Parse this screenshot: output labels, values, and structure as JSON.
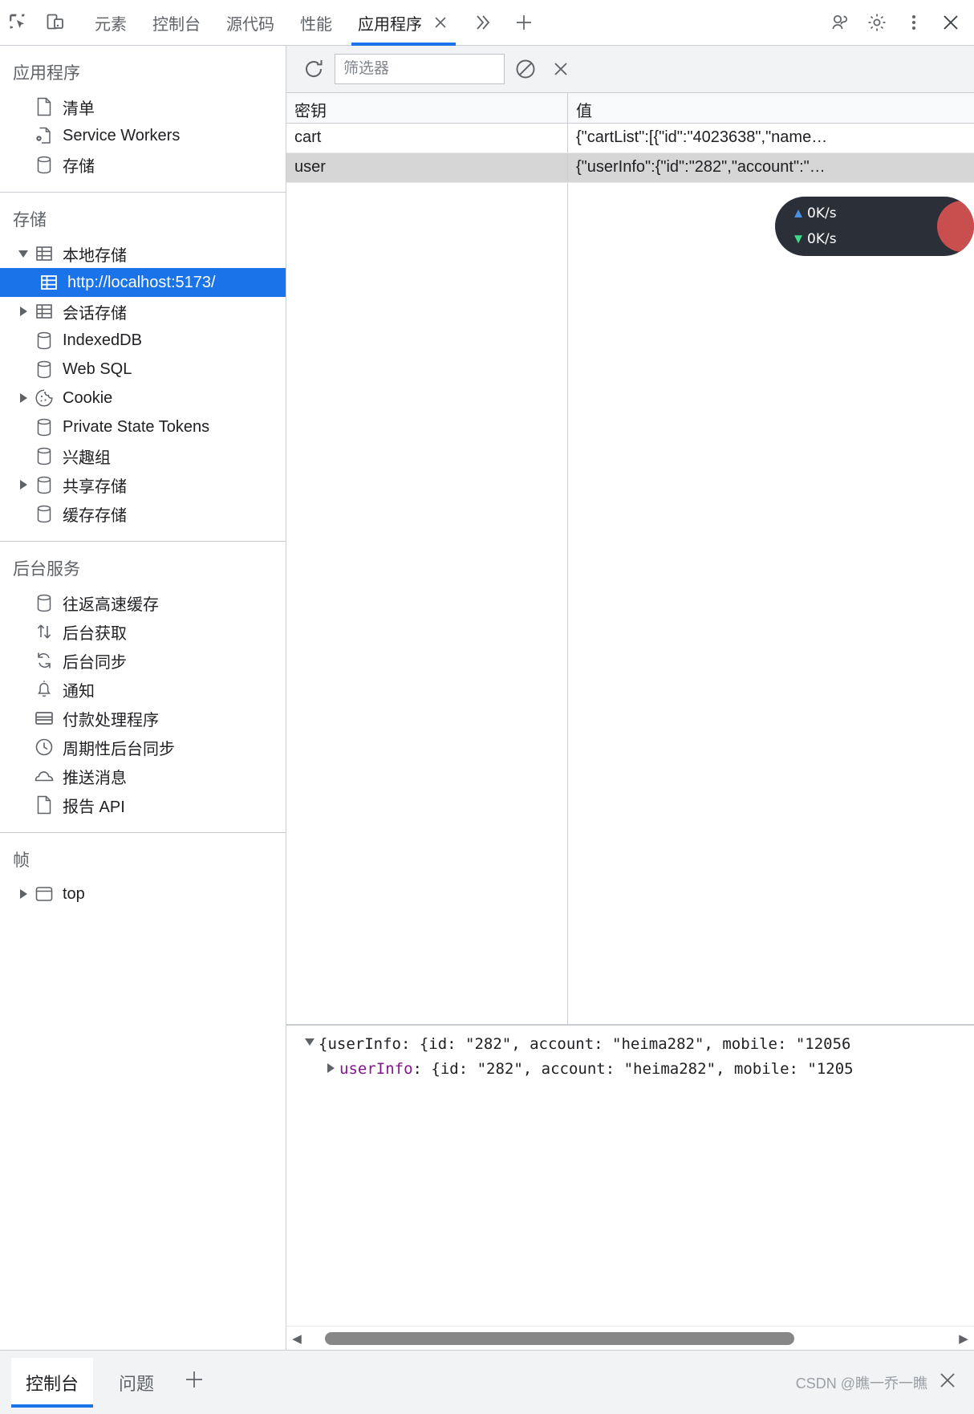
{
  "toolbar": {
    "icons": [
      {
        "name": "inspect-element-icon",
        "title": "检查"
      },
      {
        "name": "device-toolbar-icon",
        "title": "设备模拟"
      }
    ],
    "tabs": [
      {
        "label": "元素",
        "active": false
      },
      {
        "label": "控制台",
        "active": false
      },
      {
        "label": "源代码",
        "active": false
      },
      {
        "label": "性能",
        "active": false
      },
      {
        "label": "应用程序",
        "active": true,
        "closable": true
      }
    ],
    "more_tabs_label": "≫",
    "add_tab_label": "+",
    "right_icons": [
      {
        "name": "devtools-feedback-icon"
      },
      {
        "name": "gear-icon"
      },
      {
        "name": "kebab-menu-icon"
      },
      {
        "name": "close-icon"
      }
    ]
  },
  "sidebar": {
    "sections": [
      {
        "title": "应用程序",
        "items": [
          {
            "label": "清单",
            "icon": "manifest-file-icon",
            "twisty": "none",
            "indent": 1
          },
          {
            "label": "Service Workers",
            "icon": "service-worker-icon",
            "twisty": "none",
            "indent": 1
          },
          {
            "label": "存储",
            "icon": "storage-cylinder-icon",
            "twisty": "none",
            "indent": 1
          }
        ]
      },
      {
        "title": "存储",
        "items": [
          {
            "label": "本地存储",
            "icon": "table-grid-icon",
            "twisty": "expanded",
            "indent": 1
          },
          {
            "label": "http://localhost:5173/",
            "icon": "table-grid-icon",
            "twisty": "none",
            "indent": 2,
            "selected": true
          },
          {
            "label": "会话存储",
            "icon": "table-grid-icon",
            "twisty": "collapsed",
            "indent": 1
          },
          {
            "label": "IndexedDB",
            "icon": "storage-cylinder-icon",
            "twisty": "none",
            "indent": 1
          },
          {
            "label": "Web SQL",
            "icon": "storage-cylinder-icon",
            "twisty": "none",
            "indent": 1
          },
          {
            "label": "Cookie",
            "icon": "cookie-icon",
            "twisty": "collapsed",
            "indent": 1
          },
          {
            "label": "Private State Tokens",
            "icon": "storage-cylinder-icon",
            "twisty": "none",
            "indent": 1
          },
          {
            "label": "兴趣组",
            "icon": "storage-cylinder-icon",
            "twisty": "none",
            "indent": 1
          },
          {
            "label": "共享存储",
            "icon": "storage-cylinder-icon",
            "twisty": "collapsed",
            "indent": 1
          },
          {
            "label": "缓存存储",
            "icon": "storage-cylinder-icon",
            "twisty": "none",
            "indent": 1
          }
        ]
      },
      {
        "title": "后台服务",
        "items": [
          {
            "label": "往返高速缓存",
            "icon": "storage-cylinder-icon",
            "twisty": "none",
            "indent": 1
          },
          {
            "label": "后台获取",
            "icon": "background-fetch-icon",
            "twisty": "none",
            "indent": 1
          },
          {
            "label": "后台同步",
            "icon": "background-sync-icon",
            "twisty": "none",
            "indent": 1
          },
          {
            "label": "通知",
            "icon": "bell-icon",
            "twisty": "none",
            "indent": 1
          },
          {
            "label": "付款处理程序",
            "icon": "credit-card-icon",
            "twisty": "none",
            "indent": 1
          },
          {
            "label": "周期性后台同步",
            "icon": "clock-icon",
            "twisty": "none",
            "indent": 1
          },
          {
            "label": "推送消息",
            "icon": "cloud-icon",
            "twisty": "none",
            "indent": 1
          },
          {
            "label": "报告 API",
            "icon": "report-file-icon",
            "twisty": "none",
            "indent": 1
          }
        ]
      },
      {
        "title": "帧",
        "items": [
          {
            "label": "top",
            "icon": "frame-icon",
            "twisty": "collapsed",
            "indent": 1
          }
        ]
      }
    ]
  },
  "main": {
    "filter_bar": {
      "refresh_icon": "refresh-icon",
      "filter_placeholder": "筛选器",
      "filter_value": "",
      "clear_all_icon": "clear-all-icon",
      "delete_selected_icon": "delete-selected-icon"
    },
    "table": {
      "columns": [
        "密钥",
        "值"
      ],
      "rows": [
        {
          "key": "cart",
          "value": "{\"cartList\":[{\"id\":\"4023638\",\"name…",
          "selected": false
        },
        {
          "key": "user",
          "value": "{\"userInfo\":{\"id\":\"282\",\"account\":\"…",
          "selected": true
        }
      ]
    },
    "preview": {
      "lines": [
        {
          "indent": 0,
          "twisty": "expanded",
          "text": "{userInfo: {id: \"282\", account: \"heima282\", mobile: \"12056"
        },
        {
          "indent": 1,
          "twisty": "collapsed",
          "key": "userInfo",
          "text": ": {id: \"282\", account: \"heima282\", mobile: \"1205"
        }
      ]
    },
    "hscroll": {
      "left_arrow": "◀",
      "right_arrow": "▶"
    }
  },
  "drawer": {
    "tabs": [
      {
        "label": "控制台",
        "active": true
      },
      {
        "label": "问题",
        "active": false
      }
    ],
    "add_label": "+",
    "watermark": "CSDN @瞧一乔一瞧",
    "close_icon": "close-drawer-icon"
  },
  "network_pill": {
    "upload": {
      "arrow": "▲",
      "value": "0K/s"
    },
    "download": {
      "arrow": "▼",
      "value": "0K/s"
    }
  },
  "colors": {
    "accent": "#1a73e8",
    "selection": "#1a73e8",
    "row_selected": "#d6d6d6",
    "toolbar_bg": "#f1f3f4",
    "border": "#cacdd1",
    "key_purple": "#881391",
    "pill_bg": "#2b2f38",
    "upload_blue": "#4a90e2",
    "download_green": "#3ddc84"
  }
}
